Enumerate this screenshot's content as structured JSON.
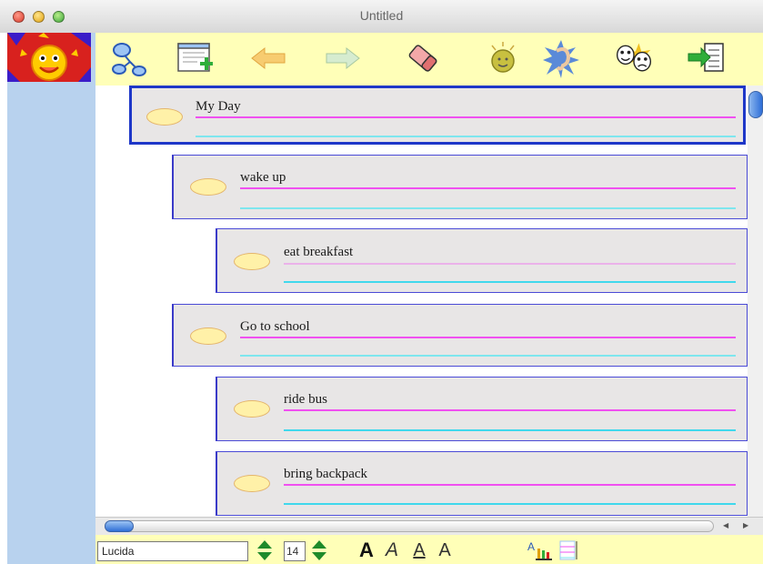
{
  "window": {
    "title": "Untitled"
  },
  "nodes": [
    {
      "id": "my-day",
      "text": "My Day",
      "selected": true
    },
    {
      "id": "wake-up",
      "text": "wake up",
      "selected": false
    },
    {
      "id": "eat-breakfast",
      "text": "eat breakfast",
      "selected": false
    },
    {
      "id": "go-to-school",
      "text": "Go to school",
      "selected": false
    },
    {
      "id": "ride-bus",
      "text": "ride bus",
      "selected": false
    },
    {
      "id": "bring-backpack",
      "text": "bring backpack",
      "selected": false
    }
  ],
  "format_bar": {
    "font_name": "Lucida",
    "font_size": "14",
    "bold_label": "A",
    "italic_label": "A",
    "outline_label": "A",
    "superscript_label": "A"
  },
  "toolbar_icons": [
    "diagram-view-icon",
    "add-topic-icon",
    "arrow-left-icon",
    "arrow-right-icon",
    "eraser-icon",
    "idea-bulb-icon",
    "ear-listen-icon",
    "theater-masks-icon",
    "export-list-icon"
  ],
  "colors": {
    "toolbar_bg": "#ffffb8",
    "sidebar_bg": "#b8d2ee",
    "node_border": "#3a3ac8",
    "line_magenta": "#f050f0",
    "line_cyan": "#7ee6ee",
    "bubble_fill": "#fff1a8"
  }
}
